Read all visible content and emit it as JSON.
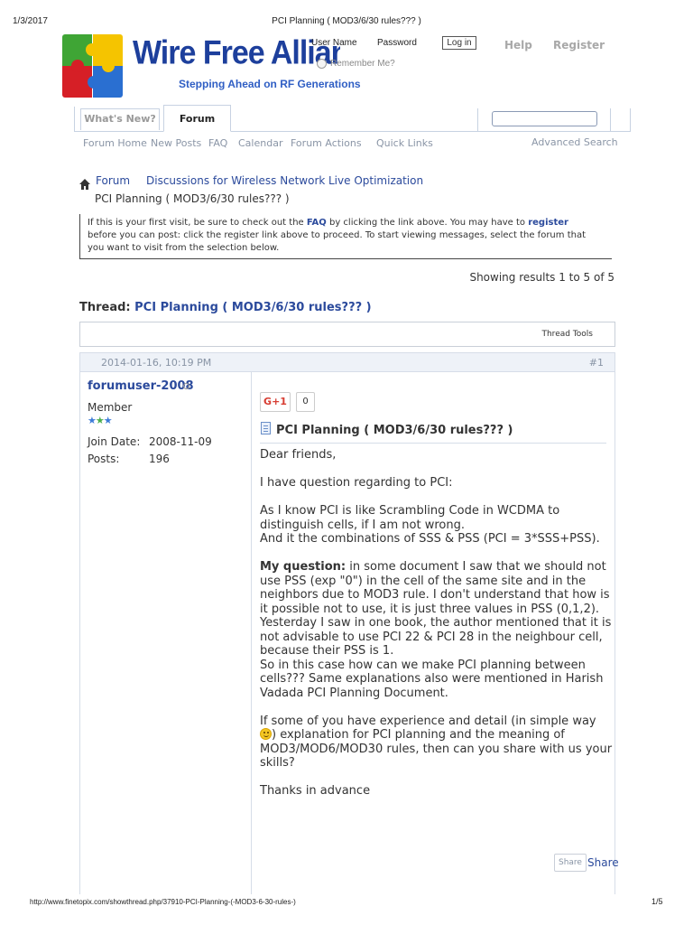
{
  "print_header": {
    "date": "1/3/2017",
    "title": "PCI Planning ( MOD3/6/30 rules??? )"
  },
  "print_footer": {
    "url": "http://www.finetopix.com/showthread.php/37910-PCI-Planning-(-MOD3-6-30-rules-)",
    "page": "1/5"
  },
  "logo": {
    "name": "Wire Free Alliance",
    "tagline": "Stepping Ahead on RF Generations",
    "colors": [
      "#3fa535",
      "#f5c400",
      "#d61f26",
      "#2a6fd1"
    ]
  },
  "login": {
    "username_label": "User Name",
    "password_label": "Password",
    "login_button": "Log in",
    "remember_label": "Remember Me?",
    "help_link": "Help",
    "register_link": "Register"
  },
  "nav": {
    "tabs": [
      "What's New?",
      "Forum"
    ],
    "active_tab": "Forum",
    "search_placeholder": "",
    "sub_links": [
      "Forum Home",
      "New Posts",
      "FAQ",
      "Calendar",
      "Forum Actions",
      "Quick Links"
    ],
    "advanced_search": "Advanced Search"
  },
  "breadcrumb": {
    "items": [
      "Forum",
      "Discussions for Wireless Network",
      "Live Optimization"
    ],
    "current": "PCI Planning ( MOD3/6/30 rules??? )"
  },
  "notice": {
    "text_1": "If this is your first visit, be sure to check out the ",
    "faq": "FAQ",
    "text_2": " by clicking the link above. You may have to ",
    "register": "register",
    "text_3": "before you can post: click the register link above to proceed. To start viewing messages, select the forum that",
    "text_4": "you want to visit from the selection below."
  },
  "results": "Showing results 1 to 5 of 5",
  "thread": {
    "prefix": "Thread: ",
    "title": "PCI Planning ( MOD3/6/30 rules??? )",
    "tools": "Thread Tools"
  },
  "post": {
    "date": "2014-01-16, 10:19 PM",
    "number": "#1",
    "user": {
      "name": "forumuser-2008",
      "rank": "Member",
      "join_label": "Join Date:",
      "join_date": "2008-11-09",
      "posts_label": "Posts:",
      "posts": "196"
    },
    "gplus_label": "G+1",
    "gplus_count": "0",
    "title": "PCI Planning ( MOD3/6/30 rules??? )",
    "lines": {
      "l1": "Dear friends,",
      "l2": "I have question regarding to PCI:",
      "l3": "As I know PCI is like Scrambling Code in WCDMA to",
      "l4": "distinguish cells, if I am not wrong.",
      "l5": "And it the combinations of SSS & PSS (PCI = 3*SSS+PSS).",
      "l6_bold": "My question:",
      "l6": " in some document I saw that we should not",
      "l7": "use PSS (exp \"0\") in the cell of the same site and in the",
      "l8": "neighbors due to MOD3 rule. I don't understand that how is",
      "l9": "it possible not to use, it is just three values in PSS (0,1,2).",
      "l10": "Yesterday I saw in one book, the author mentioned that it is",
      "l11": "not advisable to use PCI 22 & PCI 28 in the neighbour cell,",
      "l12": "because their PSS is 1.",
      "l13": "So in this case how can we make PCI planning between",
      "l14": "cells??? Same explanations also were mentioned in Harish",
      "l15": "Vadada PCI Planning Document.",
      "l16": "If some of you have experience and detail (in simple way",
      "l17": ") explanation for PCI planning and the meaning of",
      "l18": "MOD3/MOD6/MOD30 rules, then can you share with us your",
      "l19": "skills?",
      "l20": "Thanks in advance"
    },
    "share_small": "Share",
    "share_big": "Share"
  }
}
